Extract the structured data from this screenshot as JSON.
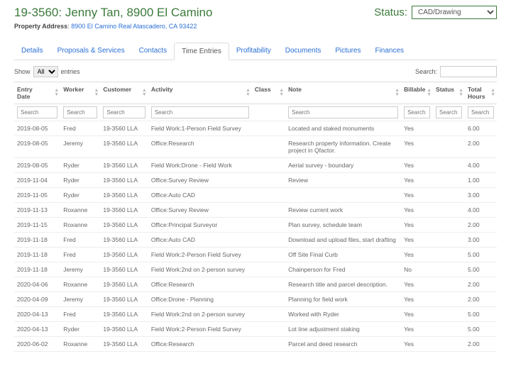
{
  "header": {
    "title": "19-3560: Jenny Tan, 8900 El Camino",
    "status_label": "Status:",
    "status_value": "CAD/Drawing",
    "addr_label": "Property Address",
    "addr_link": "8900 El Camino Real Atascadero, CA 93422"
  },
  "tabs": [
    {
      "label": "Details"
    },
    {
      "label": "Proposals & Services"
    },
    {
      "label": "Contacts"
    },
    {
      "label": "Time Entries"
    },
    {
      "label": "Profitability"
    },
    {
      "label": "Documents"
    },
    {
      "label": "Pictures"
    },
    {
      "label": "Finances"
    }
  ],
  "controls": {
    "show_label": "Show",
    "show_value": "All",
    "entries_label": "entries",
    "search_label": "Search:"
  },
  "columns": [
    "Entry Date",
    "Worker",
    "Customer",
    "Activity",
    "Class",
    "Note",
    "Billable",
    "Status",
    "Total Hours"
  ],
  "filter_placeholder": "Search",
  "rows": [
    {
      "date": "2019-08-05",
      "worker": "Fred",
      "cust": "19-3560 LLA",
      "activity": "Field Work:1-Person Field Survey",
      "note": "Located and staked monuments",
      "bill": "Yes",
      "hours": "6.00"
    },
    {
      "date": "2019-08-05",
      "worker": "Jeremy",
      "cust": "19-3560 LLA",
      "activity": "Office:Research",
      "note": "Research property information. Create project in Qfactor.",
      "bill": "Yes",
      "hours": "2.00"
    },
    {
      "date": "2019-08-05",
      "worker": "Ryder",
      "cust": "19-3560 LLA",
      "activity": "Field Work:Drone - Field Work",
      "note": "Aerial survey - boundary",
      "bill": "Yes",
      "hours": "4.00"
    },
    {
      "date": "2019-11-04",
      "worker": "Ryder",
      "cust": "19-3560 LLA",
      "activity": "Office:Survey Review",
      "note": "Review",
      "bill": "Yes",
      "hours": "1.00"
    },
    {
      "date": "2019-11-05",
      "worker": "Ryder",
      "cust": "19-3560 LLA",
      "activity": "Office:Auto CAD",
      "note": "",
      "bill": "Yes",
      "hours": "3.00"
    },
    {
      "date": "2019-11-13",
      "worker": "Roxanne",
      "cust": "19-3560 LLA",
      "activity": "Office:Survey Review",
      "note": "Review current work",
      "bill": "Yes",
      "hours": "4.00"
    },
    {
      "date": "2019-11-15",
      "worker": "Roxanne",
      "cust": "19-3560 LLA",
      "activity": "Office:Principal Surveyor",
      "note": "Plan survey, schedule team",
      "bill": "Yes",
      "hours": "2.00"
    },
    {
      "date": "2019-11-18",
      "worker": "Fred",
      "cust": "19-3560 LLA",
      "activity": "Office:Auto CAD",
      "note": "Download and upload files, start drafting",
      "bill": "Yes",
      "hours": "3.00"
    },
    {
      "date": "2019-11-18",
      "worker": "Fred",
      "cust": "19-3560 LLA",
      "activity": "Field Work:2-Person Field Survey",
      "note": "Off Site Final Curb",
      "bill": "Yes",
      "hours": "5.00"
    },
    {
      "date": "2019-11-18",
      "worker": "Jeremy",
      "cust": "19-3560 LLA",
      "activity": "Field Work:2nd on 2-person survey",
      "note": "Chainperson for Fred",
      "bill": "No",
      "hours": "5.00"
    },
    {
      "date": "2020-04-06",
      "worker": "Roxanne",
      "cust": "19-3560 LLA",
      "activity": "Office:Research",
      "note": "Research title and parcel description.",
      "bill": "Yes",
      "hours": "2.00"
    },
    {
      "date": "2020-04-09",
      "worker": "Jeremy",
      "cust": "19-3560 LLA",
      "activity": "Office:Drone - Planning",
      "note": "Planning for field work",
      "bill": "Yes",
      "hours": "2.00"
    },
    {
      "date": "2020-04-13",
      "worker": "Fred",
      "cust": "19-3560 LLA",
      "activity": "Field Work:2nd on 2-person survey",
      "note": "Worked with Ryder",
      "bill": "Yes",
      "hours": "5.00"
    },
    {
      "date": "2020-04-13",
      "worker": "Ryder",
      "cust": "19-3560 LLA",
      "activity": "Field Work:2-Person Field Survey",
      "note": "Lot line adjustment staking",
      "bill": "Yes",
      "hours": "5.00"
    },
    {
      "date": "2020-06-02",
      "worker": "Roxanne",
      "cust": "19-3560 LLA",
      "activity": "Office:Research",
      "note": "Parcel and deed research",
      "bill": "Yes",
      "hours": "2.00"
    }
  ]
}
